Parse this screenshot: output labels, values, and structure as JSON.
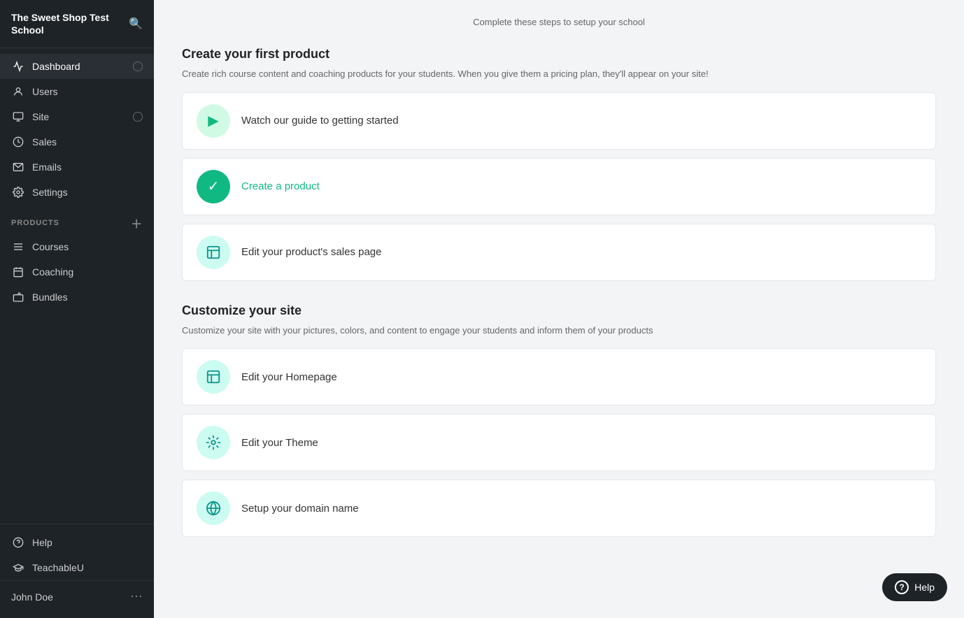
{
  "school": {
    "name": "The Sweet Shop Test School"
  },
  "page": {
    "subtitle": "Complete these steps to setup your school"
  },
  "sidebar": {
    "nav": [
      {
        "id": "dashboard",
        "label": "Dashboard",
        "icon": "📈",
        "active": true,
        "circle": true
      },
      {
        "id": "users",
        "label": "Users",
        "icon": "👤",
        "active": false,
        "circle": false
      },
      {
        "id": "site",
        "label": "Site",
        "icon": "🖥",
        "active": false,
        "circle": true
      },
      {
        "id": "sales",
        "label": "Sales",
        "icon": "💰",
        "active": false,
        "circle": false
      },
      {
        "id": "emails",
        "label": "Emails",
        "icon": "✉",
        "active": false,
        "circle": false
      },
      {
        "id": "settings",
        "label": "Settings",
        "icon": "⚙",
        "active": false,
        "circle": false
      }
    ],
    "products_section_label": "PRODUCTS",
    "products": [
      {
        "id": "courses",
        "label": "Courses",
        "icon": "📚"
      },
      {
        "id": "coaching",
        "label": "Coaching",
        "icon": "📅"
      },
      {
        "id": "bundles",
        "label": "Bundles",
        "icon": "🗂"
      }
    ],
    "footer": [
      {
        "id": "help",
        "label": "Help",
        "icon": "❓"
      },
      {
        "id": "teachableu",
        "label": "TeachableU",
        "icon": "🎓"
      }
    ],
    "user": {
      "name": "John Doe"
    }
  },
  "sections": {
    "first_product": {
      "title": "Create your first product",
      "desc": "Create rich course content and coaching products for your students. When you give them a pricing plan, they'll appear on your site!",
      "items": [
        {
          "id": "watch-guide",
          "label": "Watch our guide to getting started",
          "icon_type": "play",
          "style": "green-light"
        },
        {
          "id": "create-product",
          "label": "Create a product",
          "icon_type": "check",
          "style": "green-solid",
          "label_color": "green"
        },
        {
          "id": "edit-sales-page",
          "label": "Edit your product's sales page",
          "icon_type": "page",
          "style": "teal-light"
        }
      ]
    },
    "customize_site": {
      "title": "Customize your site",
      "desc": "Customize your site with your pictures, colors, and content to engage your students and inform them of your products",
      "items": [
        {
          "id": "edit-homepage",
          "label": "Edit your Homepage",
          "icon_type": "page",
          "style": "teal-light"
        },
        {
          "id": "edit-theme",
          "label": "Edit your Theme",
          "icon_type": "theme",
          "style": "teal-light"
        },
        {
          "id": "setup-domain",
          "label": "Setup your domain name",
          "icon_type": "www",
          "style": "teal-light"
        }
      ]
    }
  },
  "help_fab": {
    "label": "Help",
    "icon": "?"
  }
}
